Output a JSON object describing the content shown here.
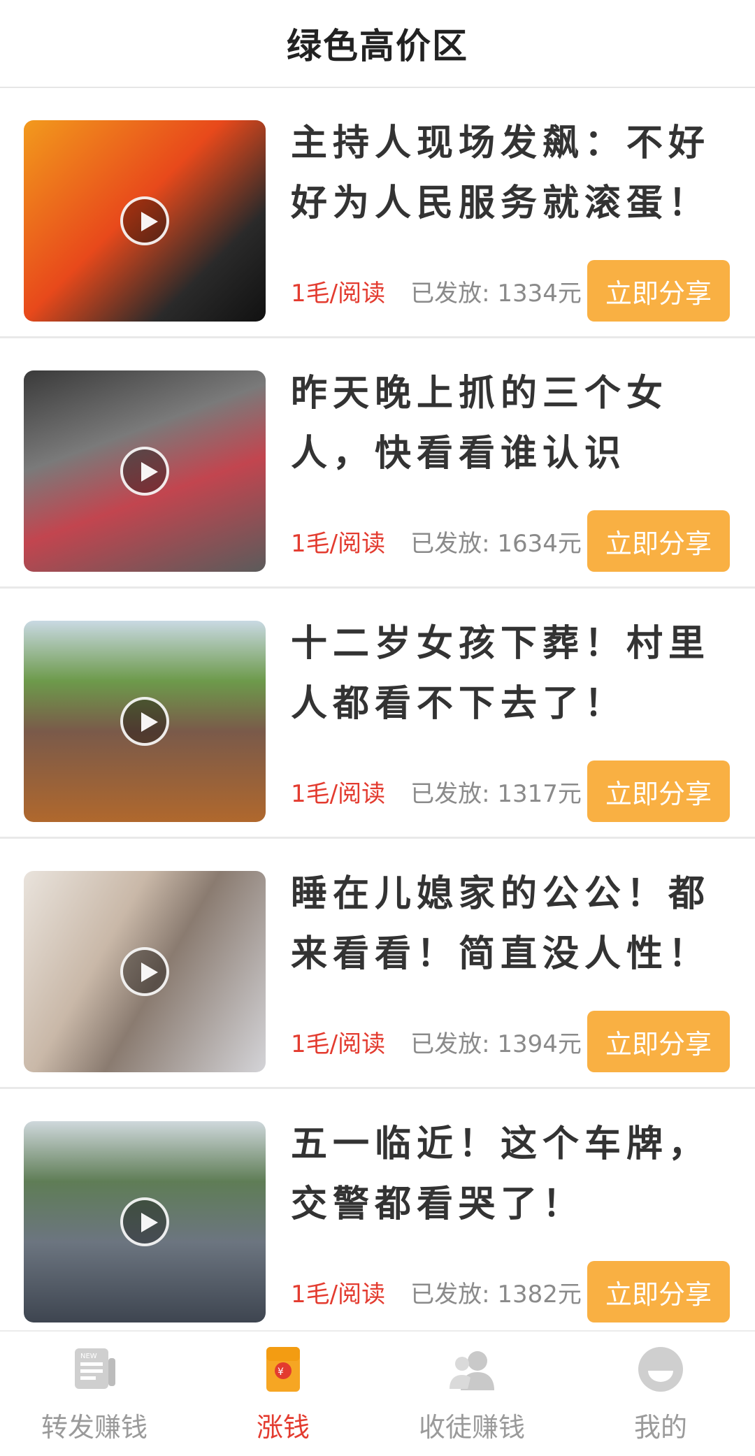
{
  "header": {
    "title": "绿色高价区"
  },
  "articles": [
    {
      "title": "主持人现场发飙：不好好为人民服务就滚蛋！",
      "price": "1毛/阅读",
      "paid": "已发放: 1334元",
      "share_label": "立即分享",
      "thumb_colors": [
        "#e8491b",
        "#f7a21b"
      ]
    },
    {
      "title": "昨天晚上抓的三个女人，快看看谁认识",
      "price": "1毛/阅读",
      "paid": "已发放: 1634元",
      "share_label": "立即分享",
      "thumb_colors": [
        "#6a6a6a",
        "#b4323e"
      ]
    },
    {
      "title": "十二岁女孩下葬！村里人都看不下去了！",
      "price": "1毛/阅读",
      "paid": "已发放: 1317元",
      "share_label": "立即分享",
      "thumb_colors": [
        "#6d9a4b",
        "#b0682d"
      ]
    },
    {
      "title": "睡在儿媳家的公公！都来看看！简直没人性！",
      "price": "1毛/阅读",
      "paid": "已发放: 1394元",
      "share_label": "立即分享",
      "thumb_colors": [
        "#d8d2cc",
        "#8a7b70"
      ]
    },
    {
      "title": "五一临近！这个车牌，交警都看哭了！",
      "price": "1毛/阅读",
      "paid": "已发放: 1382元",
      "share_label": "立即分享",
      "thumb_colors": [
        "#7a8a7a",
        "#6c7580"
      ]
    }
  ],
  "tabbar": {
    "items": [
      {
        "label": "转发赚钱",
        "icon": "news-icon",
        "active": false
      },
      {
        "label": "涨钱",
        "icon": "money-envelope-icon",
        "active": true
      },
      {
        "label": "收徒赚钱",
        "icon": "users-icon",
        "active": false
      },
      {
        "label": "我的",
        "icon": "smile-icon",
        "active": false
      }
    ]
  },
  "colors": {
    "accent": "#f9b043",
    "price": "#e33b2f",
    "muted": "#8a8a8a"
  }
}
